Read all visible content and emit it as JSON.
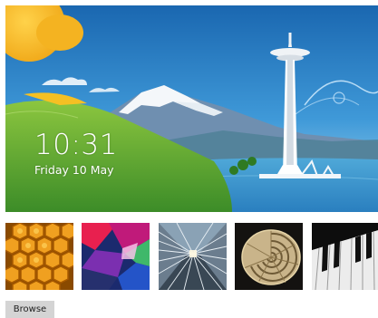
{
  "lock_screen": {
    "time": "10:31",
    "date": "Friday 10 May"
  },
  "thumbnails": [
    {
      "name": "honeycomb",
      "selected": false
    },
    {
      "name": "geometric-colors",
      "selected": false
    },
    {
      "name": "tunnel-lines",
      "selected": false
    },
    {
      "name": "nautilus-shell",
      "selected": false
    },
    {
      "name": "piano-keys",
      "selected": false
    }
  ],
  "actions": {
    "browse_label": "Browse"
  },
  "colors": {
    "sky_top": "#1d6fb5",
    "sky_bottom": "#8fd0ee",
    "sun": "#f2b21b",
    "grass": "#5aa832",
    "button_bg": "#d4d4d4"
  }
}
